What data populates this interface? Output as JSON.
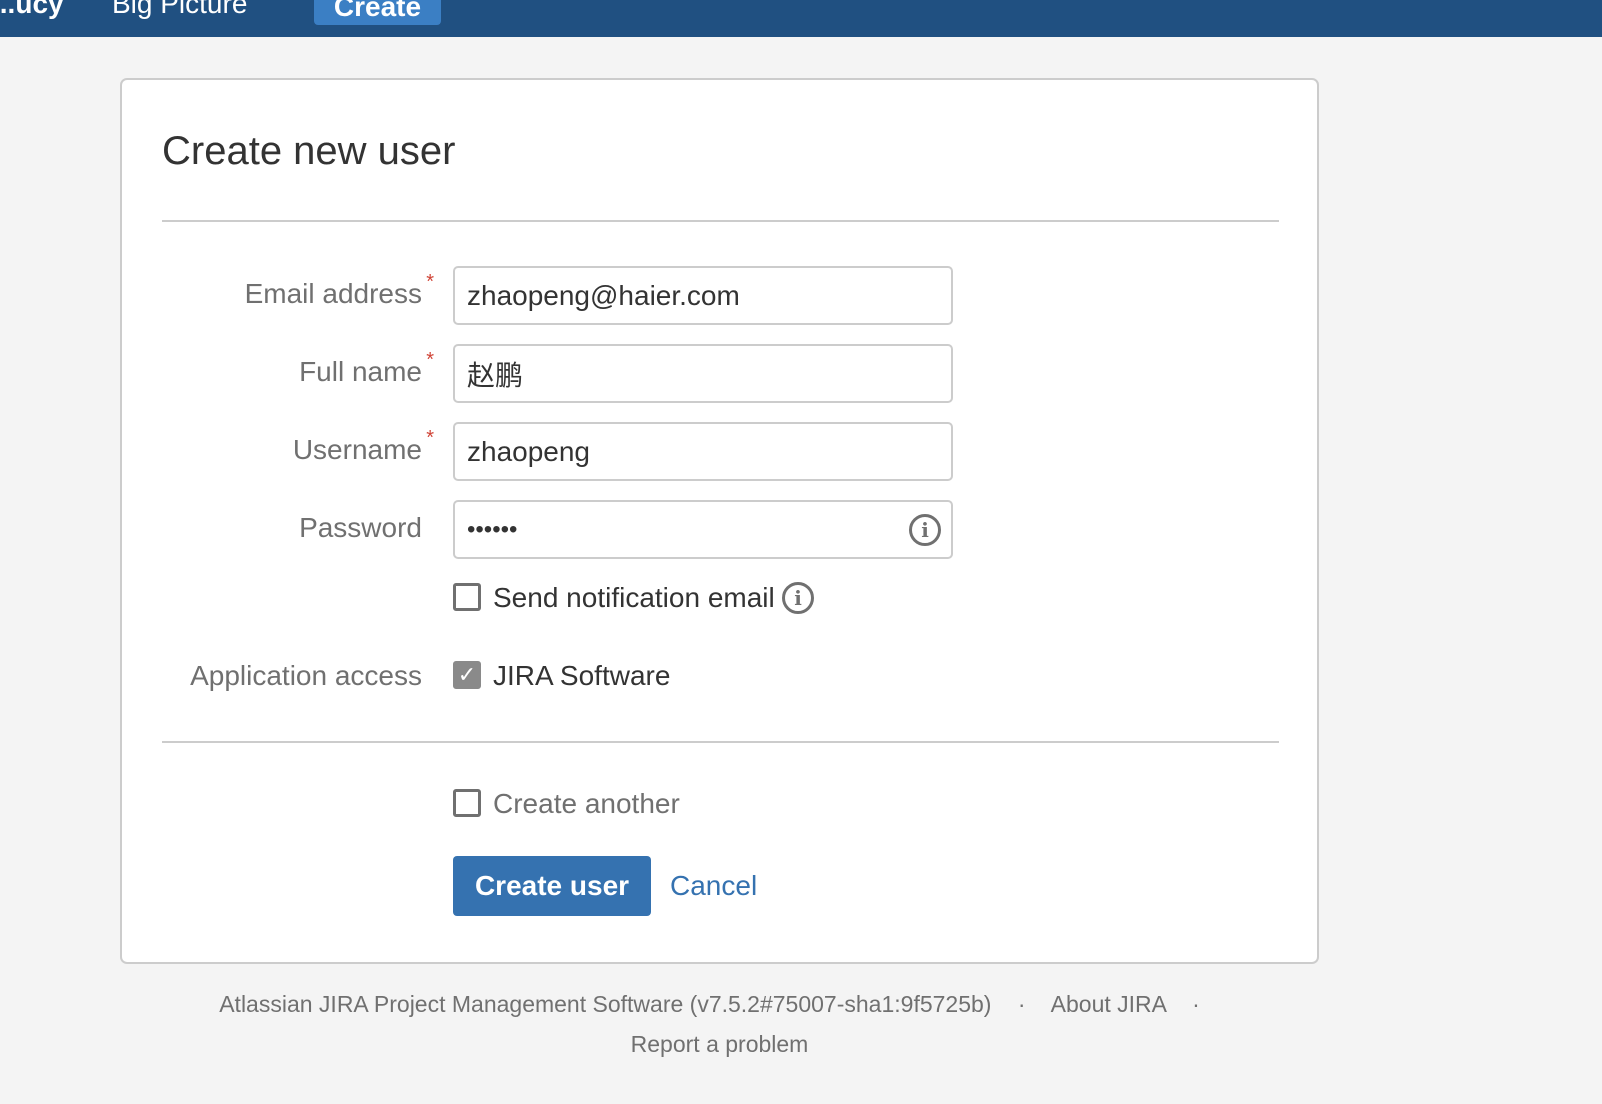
{
  "header": {
    "nav_items": [
      "...ucy",
      "Big Picture"
    ],
    "create_label": "Create",
    "background": "#205081",
    "accent": "#3b7fc4"
  },
  "form": {
    "title": "Create new user",
    "fields": {
      "email": {
        "label": "Email address",
        "required": true,
        "value": "zhaopeng@haier.com"
      },
      "full_name": {
        "label": "Full name",
        "required": true,
        "value": "赵鹏"
      },
      "username": {
        "label": "Username",
        "required": true,
        "value": "zhaopeng"
      },
      "password": {
        "label": "Password",
        "required": false,
        "value": "••••••",
        "info_icon": "info-icon"
      }
    },
    "required_marker": "*",
    "send_notification": {
      "label": "Send notification email",
      "checked": false,
      "info_icon": "info-icon"
    },
    "application_access": {
      "label": "Application access",
      "option_label": "JIRA Software",
      "checked": true
    },
    "create_another": {
      "label": "Create another",
      "checked": false
    },
    "create_button_label": "Create user",
    "cancel_label": "Cancel",
    "primary_color": "#3572b0",
    "required_color": "#d04437"
  },
  "footer": {
    "product_text": "Atlassian JIRA Project Management Software (v7.5.2#75007-sha1:9f5725b)",
    "separator": "·",
    "about_link": "About JIRA",
    "report_link": "Report a problem"
  }
}
